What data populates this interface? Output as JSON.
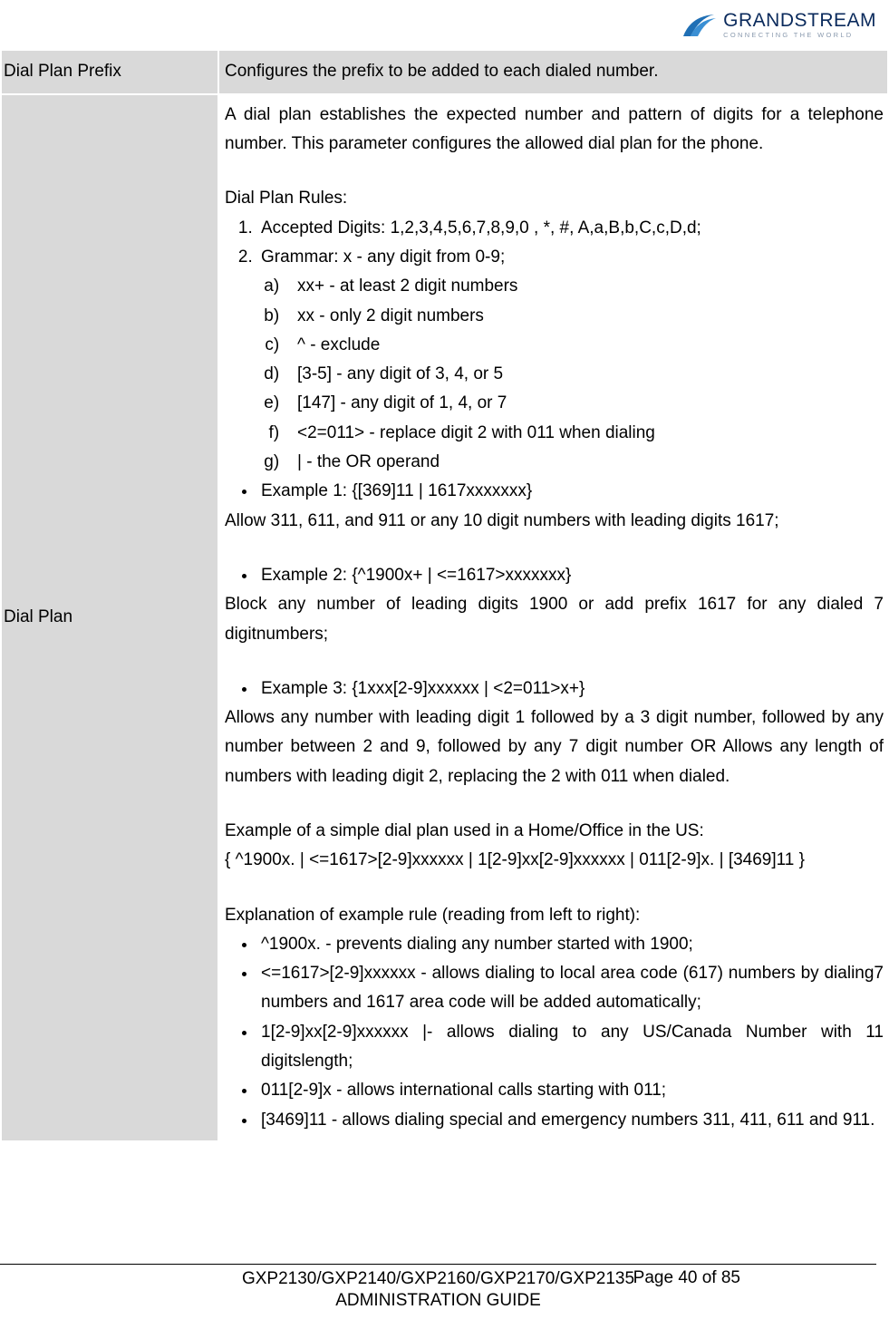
{
  "logo": {
    "brand": "GRANDSTREAM",
    "tagline": "CONNECTING THE WORLD"
  },
  "row1": {
    "label": "Dial Plan Prefix",
    "desc": "Configures the prefix to be added to each dialed number."
  },
  "row2": {
    "label": "Dial Plan",
    "intro": "A dial plan establishes the expected number and pattern of digits for a telephone number. This parameter configures the allowed dial plan for the phone.",
    "rulesHeading": "Dial Plan Rules:",
    "num1": "Accepted Digits: 1,2,3,4,5,6,7,8,9,0 , *, #, A,a,B,b,C,c,D,d;",
    "num2": "Grammar: x - any digit from 0-9;",
    "a": "xx+ - at least 2 digit numbers",
    "b": "xx - only 2 digit numbers",
    "c": "^ - exclude",
    "d": "[3-5] - any digit of 3, 4, or 5",
    "e": "[147] - any digit of 1, 4, or 7",
    "f": "<2=011> - replace digit 2 with 011 when dialing",
    "g": "| - the OR operand",
    "ex1": "Example 1: {[369]11 | 1617xxxxxxx}",
    "ex1desc": "Allow 311, 611, and 911 or any 10 digit numbers with leading digits 1617;",
    "ex2": "Example 2: {^1900x+ | <=1617>xxxxxxx}",
    "ex2desc": "Block any number of leading digits 1900 or add prefix 1617 for any dialed 7 digitnumbers;",
    "ex3": "Example 3: {1xxx[2-9]xxxxxx | <2=011>x+}",
    "ex3desc": "Allows any number with leading digit 1 followed by a 3 digit number, followed by any number between 2 and 9, followed by any 7 digit number OR Allows any length of numbers with leading digit 2, replacing the 2 with 011 when dialed.",
    "simpleHeading": "Example of a simple dial plan used in a Home/Office in the US:",
    "simpleRule": "{ ^1900x. | <=1617>[2-9]xxxxxx | 1[2-9]xx[2-9]xxxxxx | 011[2-9]x. | [3469]11 }",
    "explainHeading": "Explanation of example rule (reading from left to right):",
    "exp1": "^1900x. - prevents dialing any number started with 1900;",
    "exp2": "<=1617>[2-9]xxxxxx - allows dialing to local area code (617) numbers by dialing7 numbers and 1617 area code will be added automatically;",
    "exp3": "1[2-9]xx[2-9]xxxxxx |- allows dialing to any US/Canada Number with 11 digitslength;",
    "exp4": "011[2-9]x - allows international calls starting with 011;",
    "exp5": "[3469]11 - allows dialing special and emergency numbers 311, 411, 611 and 911."
  },
  "footer": {
    "title1": "GXP2130/GXP2140/GXP2160/GXP2170/GXP2135",
    "title2": "ADMINISTRATION GUIDE",
    "page": "Page 40 of 85"
  }
}
